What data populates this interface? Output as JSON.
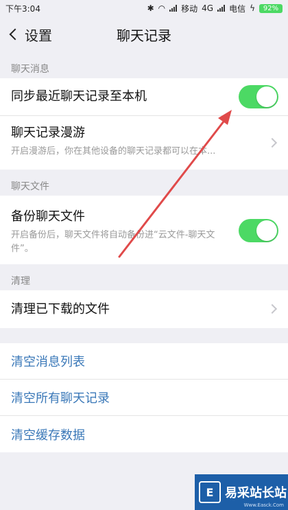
{
  "status_bar": {
    "time": "下午3:04",
    "carrier1": "移动",
    "network": "4G",
    "carrier2": "电信",
    "battery": "92%"
  },
  "nav": {
    "back_label": "设置",
    "title": "聊天记录"
  },
  "sections": {
    "messages": {
      "header": "聊天消息",
      "sync_title": "同步最近聊天记录至本机",
      "sync_enabled": true,
      "roaming_title": "聊天记录漫游",
      "roaming_sub": "开启漫游后，你在其他设备的聊天记录都可以在本..."
    },
    "files": {
      "header": "聊天文件",
      "backup_title": "备份聊天文件",
      "backup_sub": "开启备份后，聊天文件将自动备份进“云文件-聊天文件”。",
      "backup_enabled": true
    },
    "cleanup": {
      "header": "清理",
      "clear_downloads": "清理已下载的文件"
    }
  },
  "actions": {
    "clear_message_list": "清空消息列表",
    "clear_all_records": "清空所有聊天记录",
    "clear_cache": "清空缓存数据"
  },
  "watermark": {
    "brand": "易采站长站",
    "url": "Www.Easck.Com"
  },
  "colors": {
    "toggle_on": "#4cd964",
    "link_blue": "#3a78b8",
    "annotation_arrow": "#e04a4a"
  }
}
